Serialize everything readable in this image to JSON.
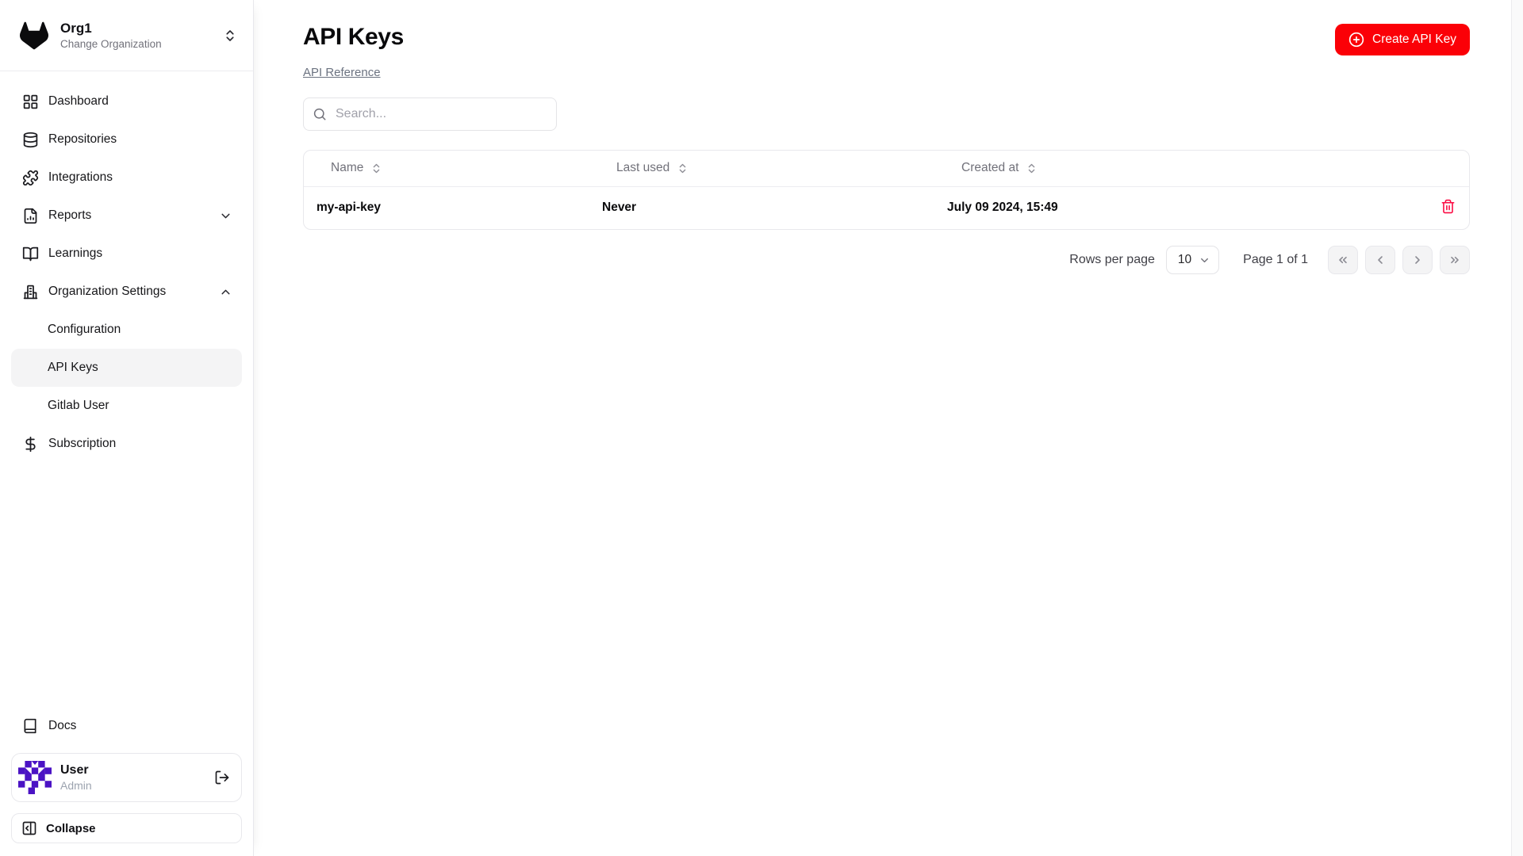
{
  "colors": {
    "accent_red": "#fb0007",
    "danger": "#fb0a43",
    "avatar_purple": "#4b13c4"
  },
  "sidebar": {
    "org": {
      "name": "Org1",
      "subtitle": "Change Organization"
    },
    "items": [
      {
        "label": "Dashboard"
      },
      {
        "label": "Repositories"
      },
      {
        "label": "Integrations"
      },
      {
        "label": "Reports"
      },
      {
        "label": "Learnings"
      },
      {
        "label": "Organization Settings"
      },
      {
        "label": "Configuration"
      },
      {
        "label": "API Keys"
      },
      {
        "label": "Gitlab User"
      },
      {
        "label": "Subscription"
      }
    ],
    "docs_label": "Docs",
    "user": {
      "name": "User",
      "role": "Admin"
    },
    "collapse_label": "Collapse"
  },
  "main": {
    "title": "API Keys",
    "reference_link": "API Reference",
    "search_placeholder": "Search...",
    "create_button": "Create API Key",
    "table": {
      "columns": [
        "Name",
        "Last used",
        "Created at"
      ],
      "rows": [
        {
          "name": "my-api-key",
          "last_used": "Never",
          "created_at": "July 09 2024, 15:49"
        }
      ]
    },
    "pagination": {
      "rows_per_page_label": "Rows per page",
      "rows_per_page_value": "10",
      "page_label": "Page 1 of 1"
    }
  }
}
